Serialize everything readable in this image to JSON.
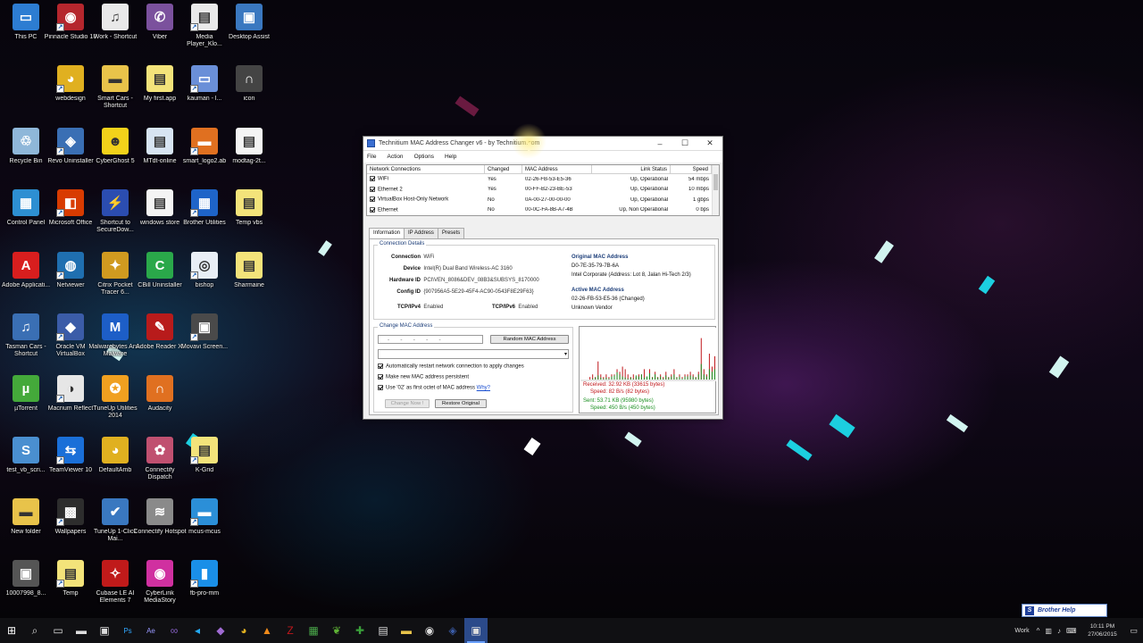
{
  "desktop": {
    "icons": [
      {
        "label": "This PC",
        "icon": "pc-icon",
        "color": "#2d7dd2",
        "glyph": "▭"
      },
      {
        "label": "Pinnacle Studio 18",
        "icon": "pinnacle-icon",
        "color": "#b5262d",
        "glyph": "◉"
      },
      {
        "label": "Work - Shortcut",
        "icon": "document-icon",
        "color": "#e9e9e9",
        "glyph": "♫"
      },
      {
        "label": "Viber",
        "icon": "viber-icon",
        "color": "#7b519d",
        "glyph": "✆"
      },
      {
        "label": "Media Player_Klo...",
        "icon": "media-file-icon",
        "color": "#e9e9e9",
        "glyph": "▤"
      },
      {
        "label": "Desktop Assist",
        "icon": "desktop-assist-icon",
        "color": "#3a78c0",
        "glyph": "▣"
      },
      {
        "label": "",
        "icon": "empty",
        "color": "",
        "glyph": ""
      },
      {
        "label": "webdesign",
        "icon": "chrome-icon",
        "color": "#e0b020",
        "glyph": "◕"
      },
      {
        "label": "Smart Cars - Shortcut",
        "icon": "folder-icon",
        "color": "#e8c34a",
        "glyph": "▬"
      },
      {
        "label": "My first.app",
        "icon": "document-icon",
        "color": "#f3e37a",
        "glyph": "▤"
      },
      {
        "label": "kauman - l...",
        "icon": "file-icon",
        "color": "#6a8fd8",
        "glyph": "▭"
      },
      {
        "label": "icon",
        "icon": "headphones-icon",
        "color": "#444444",
        "glyph": "∩"
      },
      {
        "label": "Recycle Bin",
        "icon": "recycle-bin-icon",
        "color": "#8fb7d9",
        "glyph": "♲"
      },
      {
        "label": "Revo Uninstaller",
        "icon": "revo-icon",
        "color": "#3a6fb4",
        "glyph": "◈"
      },
      {
        "label": "CyberGhost 5",
        "icon": "cyberghost-icon",
        "color": "#f2d21a",
        "glyph": "☻"
      },
      {
        "label": "MTdt-online",
        "icon": "document-icon",
        "color": "#d7e4f2",
        "glyph": "▤"
      },
      {
        "label": "smart_logo2.ab",
        "icon": "file-icon",
        "color": "#e07020",
        "glyph": "▬"
      },
      {
        "label": "modtag-2t...",
        "icon": "document-icon",
        "color": "#f4f4f4",
        "glyph": "▤"
      },
      {
        "label": "Control Panel",
        "icon": "control-panel-icon",
        "color": "#2d8fd2",
        "glyph": "▦"
      },
      {
        "label": "Microsoft Office",
        "icon": "office-icon",
        "color": "#d83b01",
        "glyph": "◧"
      },
      {
        "label": "Shortcut to SecureDow...",
        "icon": "shortcut-icon",
        "color": "#2b4db0",
        "glyph": "⚡"
      },
      {
        "label": "windows store",
        "icon": "document-icon",
        "color": "#f4f4f4",
        "glyph": "▤"
      },
      {
        "label": "Brother Utilities",
        "icon": "brother-utilities-icon",
        "color": "#1e64c8",
        "glyph": "▦"
      },
      {
        "label": "Temp vbs",
        "icon": "script-icon",
        "color": "#f3e37a",
        "glyph": "▤"
      },
      {
        "label": "Adobe Applicati...",
        "icon": "adobe-icon",
        "color": "#d81e1e",
        "glyph": "A"
      },
      {
        "label": "Netviewer",
        "icon": "globe-icon",
        "color": "#1f6fb0",
        "glyph": "◍"
      },
      {
        "label": "Citrix Pocket Tracer 6...",
        "icon": "citrix-icon",
        "color": "#d09a20",
        "glyph": "✦"
      },
      {
        "label": "CBill Uninstaller",
        "icon": "ccleaner-icon",
        "color": "#2aa84a",
        "glyph": "C"
      },
      {
        "label": "bishop",
        "icon": "bishop-icon",
        "color": "#e8eef6",
        "glyph": "◎"
      },
      {
        "label": "Sharmaine",
        "icon": "document-icon",
        "color": "#f3e37a",
        "glyph": "▤"
      },
      {
        "label": "Tasman Cars - Shortcut",
        "icon": "document-icon",
        "color": "#3a6fb4",
        "glyph": "♫"
      },
      {
        "label": "Oracle VM VirtualBox",
        "icon": "virtualbox-icon",
        "color": "#3b5ca8",
        "glyph": "◆"
      },
      {
        "label": "Malwarebytes Anti-Malware",
        "icon": "malwarebytes-icon",
        "color": "#1d5ec7",
        "glyph": "M"
      },
      {
        "label": "Adobe Reader XI",
        "icon": "adobe-reader-icon",
        "color": "#b81b1b",
        "glyph": "✎"
      },
      {
        "label": "Movavi Screen...",
        "icon": "movavi-icon",
        "color": "#4a4a4a",
        "glyph": "▣"
      },
      {
        "label": "",
        "icon": "empty",
        "color": "",
        "glyph": ""
      },
      {
        "label": "µTorrent",
        "icon": "utorrent-icon",
        "color": "#44a93a",
        "glyph": "µ"
      },
      {
        "label": "Macrium Reflect",
        "icon": "macrium-icon",
        "color": "#e6e6e6",
        "glyph": "◑"
      },
      {
        "label": "TuneUp Utilities 2014",
        "icon": "tuneup-icon",
        "color": "#f0a020",
        "glyph": "✪"
      },
      {
        "label": "Audacity",
        "icon": "audacity-icon",
        "color": "#e07020",
        "glyph": "∩"
      },
      {
        "label": "",
        "icon": "empty",
        "color": "",
        "glyph": ""
      },
      {
        "label": "",
        "icon": "empty",
        "color": "",
        "glyph": ""
      },
      {
        "label": "test_vb_scri...",
        "icon": "script-icon",
        "color": "#4a8fd0",
        "glyph": "S"
      },
      {
        "label": "TeamViewer 10",
        "icon": "teamviewer-icon",
        "color": "#1a6fd8",
        "glyph": "⇆"
      },
      {
        "label": "DefaultAmb",
        "icon": "chrome-icon",
        "color": "#e0b020",
        "glyph": "◕"
      },
      {
        "label": "Connectify Dispatch",
        "icon": "connectify-icon",
        "color": "#c05070",
        "glyph": "✿"
      },
      {
        "label": "K-Grid",
        "icon": "document-icon",
        "color": "#f3e37a",
        "glyph": "▤"
      },
      {
        "label": "",
        "icon": "empty",
        "color": "",
        "glyph": ""
      },
      {
        "label": "New folder",
        "icon": "folder-icon",
        "color": "#e8c34a",
        "glyph": "▬"
      },
      {
        "label": "Wallpapers",
        "icon": "wallpaper-icon",
        "color": "#2d2d2d",
        "glyph": "▩"
      },
      {
        "label": "TuneUp 1-Click Mai...",
        "icon": "tuneup-icon",
        "color": "#3a78c0",
        "glyph": "✔"
      },
      {
        "label": "Connectify Hotspot",
        "icon": "wifi-icon",
        "color": "#8a8a8a",
        "glyph": "≋"
      },
      {
        "label": "mcus-mcus",
        "icon": "file-icon",
        "color": "#2b8fd8",
        "glyph": "▬"
      },
      {
        "label": "",
        "icon": "empty",
        "color": "",
        "glyph": ""
      },
      {
        "label": "10007998_8...",
        "icon": "image-icon",
        "color": "#555555",
        "glyph": "▣"
      },
      {
        "label": "Temp",
        "icon": "document-icon",
        "color": "#f3e37a",
        "glyph": "▤"
      },
      {
        "label": "Cubase LE AI Elements 7",
        "icon": "cubase-icon",
        "color": "#c01a1a",
        "glyph": "✧"
      },
      {
        "label": "CyberLink MediaStory",
        "icon": "cyberlink-icon",
        "color": "#d030a0",
        "glyph": "◉"
      },
      {
        "label": "fb-pro-mm",
        "icon": "file-icon",
        "color": "#1a8fe8",
        "glyph": "▮"
      },
      {
        "label": "",
        "icon": "empty",
        "color": "",
        "glyph": ""
      }
    ]
  },
  "app": {
    "title": "Technitium MAC Address Changer v6 - by Technitium.com",
    "menu": [
      "File",
      "Action",
      "Options",
      "Help"
    ],
    "connections_headers": [
      "Network Connections",
      "Changed",
      "MAC Address",
      "Link Status",
      "Speed"
    ],
    "connections": [
      {
        "name": "WiFi",
        "changed": "Yes",
        "mac": "02-26-FB-53-E5-36",
        "status": "Up, Operational",
        "speed": "54 mbps",
        "checked": true
      },
      {
        "name": "Ethernet 2",
        "changed": "Yes",
        "mac": "00-FF-B2-23-BE-53",
        "status": "Up, Operational",
        "speed": "10 mbps",
        "checked": true
      },
      {
        "name": "VirtualBox Host-Only Network",
        "changed": "No",
        "mac": "0A-00-27-00-00-00",
        "status": "Up, Operational",
        "speed": "1 gbps",
        "checked": true
      },
      {
        "name": "Ethernet",
        "changed": "No",
        "mac": "00-0C-FA-8B-A7-4B",
        "status": "Up, Non Operational",
        "speed": "0 bps",
        "checked": true
      }
    ],
    "tabs": [
      "Information",
      "IP Address",
      "Presets"
    ],
    "details": {
      "group_title": "Connection Details",
      "connection_label": "Connection",
      "connection_value": "WiFi",
      "device_label": "Device",
      "device_value": "Intel(R) Dual Band Wireless-AC 3160",
      "hardware_id_label": "Hardware ID",
      "hardware_id_value": "PCI\\VEN_8086&DEV_08B3&SUBSYS_8170000",
      "config_id_label": "Config ID",
      "config_id_value": "{907956A5-5E29-45F4-AC90-0543F8E29F63}",
      "tcpv4_label": "TCP/IPv4",
      "tcpv4_value": "Enabled",
      "tcpv6_label": "TCP/IPv6",
      "tcpv6_value": "Enabled",
      "original_mac_title": "Original MAC Address",
      "original_mac_value": "D0-7E-35-79-7B-6A",
      "original_mac_vendor": "Intel Corporate (Address: Lot 8, Jalan Hi-Tech 2/3)",
      "active_mac_title": "Active MAC Address",
      "active_mac_value": "02-26-FB-53-E5-36 (Changed)",
      "active_mac_vendor": "Unknown Vendor"
    },
    "change": {
      "group_title": "Change MAC Address",
      "mac_placeholder": "  -   -   -   -   -  ",
      "random_button": "Random MAC Address",
      "options": [
        {
          "label": "Automatically restart network connection to apply changes",
          "checked": true
        },
        {
          "label": "Make new MAC address persistent",
          "checked": true
        },
        {
          "label": "Use '02' as first octet of MAC address",
          "checked": true
        }
      ],
      "why_link": "Why?",
      "change_now_button": "Change Now !",
      "restore_button": "Restore Original"
    },
    "stats": {
      "received": "Received: 32.92 KB (33615 bytes)",
      "received_speed": "Speed: 82 B/s (82 bytes)",
      "sent": "Sent: 53.71 KB (95980 bytes)",
      "sent_speed": "Speed: 450 B/s (450 bytes)",
      "received_color": "#c0171b",
      "sent_color": "#1a8f20",
      "graph_recv": [
        0,
        0,
        0,
        0.05,
        0.1,
        0.05,
        0.35,
        0.1,
        0.05,
        0.1,
        0.05,
        0.1,
        0.1,
        0.2,
        0.15,
        0.25,
        0.2,
        0.1,
        0.05,
        0.1,
        0.05,
        0.1,
        0.1,
        0.2,
        0.05,
        0.2,
        0.05,
        0.15,
        0.05,
        0.1,
        0.05,
        0.15,
        0.05,
        0.1,
        0.2,
        0.05,
        0.1,
        0.05,
        0.1,
        0.1,
        0.15,
        0.1,
        0.05,
        0.15,
        0.8,
        0.2,
        0.1,
        0.5,
        0.25,
        0.45
      ],
      "graph_sent": [
        0,
        0,
        0,
        0,
        0.02,
        0.04,
        0.08,
        0.04,
        0.02,
        0.04,
        0.02,
        0.06,
        0.08,
        0.14,
        0.1,
        0.06,
        0.04,
        0.02,
        0.04,
        0.02,
        0.08,
        0.06,
        0.1,
        0.04,
        0.06,
        0.12,
        0.04,
        0.1,
        0.04,
        0.06,
        0.02,
        0.08,
        0.04,
        0.06,
        0.1,
        0.04,
        0.06,
        0.02,
        0.06,
        0.06,
        0.08,
        0.06,
        0.04,
        0.1,
        0.3,
        0.1,
        0.06,
        0.2,
        0.15,
        0.2
      ]
    }
  },
  "taskbar": {
    "apps": [
      "start-icon",
      "search-icon",
      "task-view-icon",
      "file-explorer-icon",
      "store-icon",
      "photoshop-icon",
      "after-effects-icon",
      "visual-studio-icon",
      "vscode-icon",
      "vs-blend-icon",
      "chrome-icon",
      "vlc-icon",
      "filezilla-icon",
      "camtasia-icon",
      "evernote-icon",
      "greenshot-icon",
      "terminal-icon",
      "folder-icon",
      "media-icon",
      "virtualbox-icon",
      "mac-changer-icon"
    ],
    "tray_label": "Work",
    "time": "10:11 PM",
    "date": "27/06/2015"
  },
  "notification": {
    "brother_help": "Brother Help"
  }
}
